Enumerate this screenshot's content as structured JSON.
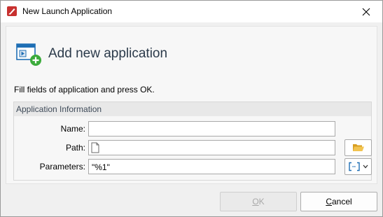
{
  "window": {
    "title": "New Launch Application",
    "close_icon": "close-icon"
  },
  "header": {
    "icon": "application-add-icon",
    "title": "Add new application"
  },
  "instruction": "Fill fields of application and press OK.",
  "group": {
    "title": "Application Information",
    "name_label": "Name:",
    "name_value": "",
    "path_label": "Path:",
    "path_value": "",
    "parameters_label": "Parameters:",
    "parameters_value": "\"%1\""
  },
  "buttons": {
    "ok_mnemonic": "O",
    "ok_rest": "K",
    "ok_enabled": false,
    "cancel_mnemonic": "C",
    "cancel_rest": "ancel"
  },
  "colors": {
    "accent": "#1f6fb5",
    "add_badge": "#3cab3c",
    "folder": "#e8b339"
  }
}
